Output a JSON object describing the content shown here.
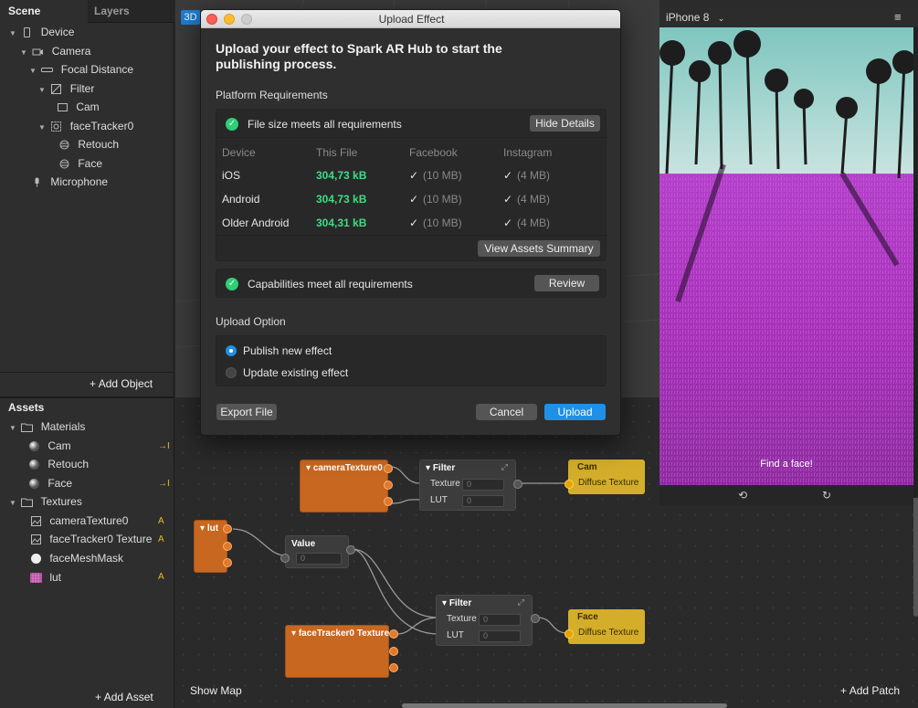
{
  "scene_panel": {
    "tabs": [
      "Scene",
      "Layers"
    ],
    "tree": [
      {
        "label": "Device",
        "icon": "phone-icon"
      },
      {
        "label": "Camera",
        "icon": "camera-icon"
      },
      {
        "label": "Focal Distance",
        "icon": "focal-distance-icon"
      },
      {
        "label": "Filter",
        "icon": "filter-icon"
      },
      {
        "label": "Cam",
        "icon": "rectangle-icon"
      },
      {
        "label": "faceTracker0",
        "icon": "face-tracker-icon"
      },
      {
        "label": "Retouch",
        "icon": "face-mesh-icon"
      },
      {
        "label": "Face",
        "icon": "face-mesh-icon"
      },
      {
        "label": "Microphone",
        "icon": "microphone-icon"
      }
    ],
    "add_object": "Add Object"
  },
  "assets_panel": {
    "title": "Assets",
    "close": "×",
    "materials_label": "Materials",
    "materials": [
      "Cam",
      "Retouch",
      "Face"
    ],
    "textures_label": "Textures",
    "textures": [
      "cameraTexture0",
      "faceTracker0 Texture",
      "faceMeshMask",
      "lut"
    ],
    "badge": "A",
    "add_asset": "Add Asset"
  },
  "viewport": {
    "mode": "3D"
  },
  "phone": {
    "device": "iPhone 8",
    "hint": "Find a face!"
  },
  "dialog": {
    "title": "Upload Effect",
    "heading": "Upload your effect to Spark AR Hub to start the publishing process.",
    "platform_title": "Platform Requirements",
    "filesize_status": "File size meets all requirements",
    "hide_details": "Hide Details",
    "columns": [
      "Device",
      "This File",
      "Facebook",
      "Instagram"
    ],
    "rows": [
      {
        "device": "iOS",
        "size": "304,73 kB",
        "facebook": "(10 MB)",
        "instagram": "(4 MB)"
      },
      {
        "device": "Android",
        "size": "304,73 kB",
        "facebook": "(10 MB)",
        "instagram": "(4 MB)"
      },
      {
        "device": "Older Android",
        "size": "304,31 kB",
        "facebook": "(10 MB)",
        "instagram": "(4 MB)"
      }
    ],
    "tick": "✓",
    "view_assets": "View Assets Summary",
    "capabilities_status": "Capabilities meet all requirements",
    "review": "Review",
    "upload_option_title": "Upload Option",
    "option_publish": "Publish new effect",
    "option_update": "Update existing effect",
    "selected_option": "Publish new effect",
    "export_file": "Export File",
    "cancel": "Cancel",
    "upload": "Upload"
  },
  "patch_editor": {
    "show_map": "Show Map",
    "add_patch": "Add Patch",
    "nodes": {
      "camera_texture": "cameraTexture0",
      "lut": "lut",
      "value": {
        "title": "Value",
        "value": "0"
      },
      "facetracker_texture": "faceTracker0 Texture",
      "filter1": {
        "title": "Filter",
        "texture": "Texture",
        "lut": "LUT",
        "texture_val": "0",
        "lut_val": "0"
      },
      "filter2": {
        "title": "Filter",
        "texture": "Texture",
        "lut": "LUT",
        "texture_val": "0",
        "lut_val": "0"
      },
      "cam": {
        "title": "Cam",
        "port": "Diffuse Texture"
      },
      "face": {
        "title": "Face",
        "port": "Diffuse Texture"
      }
    }
  },
  "colors": {
    "accent": "#1e90e8",
    "ok": "#2ecf77",
    "patch_orange": "#c8671f",
    "patch_yellow": "#d4ae2a"
  }
}
